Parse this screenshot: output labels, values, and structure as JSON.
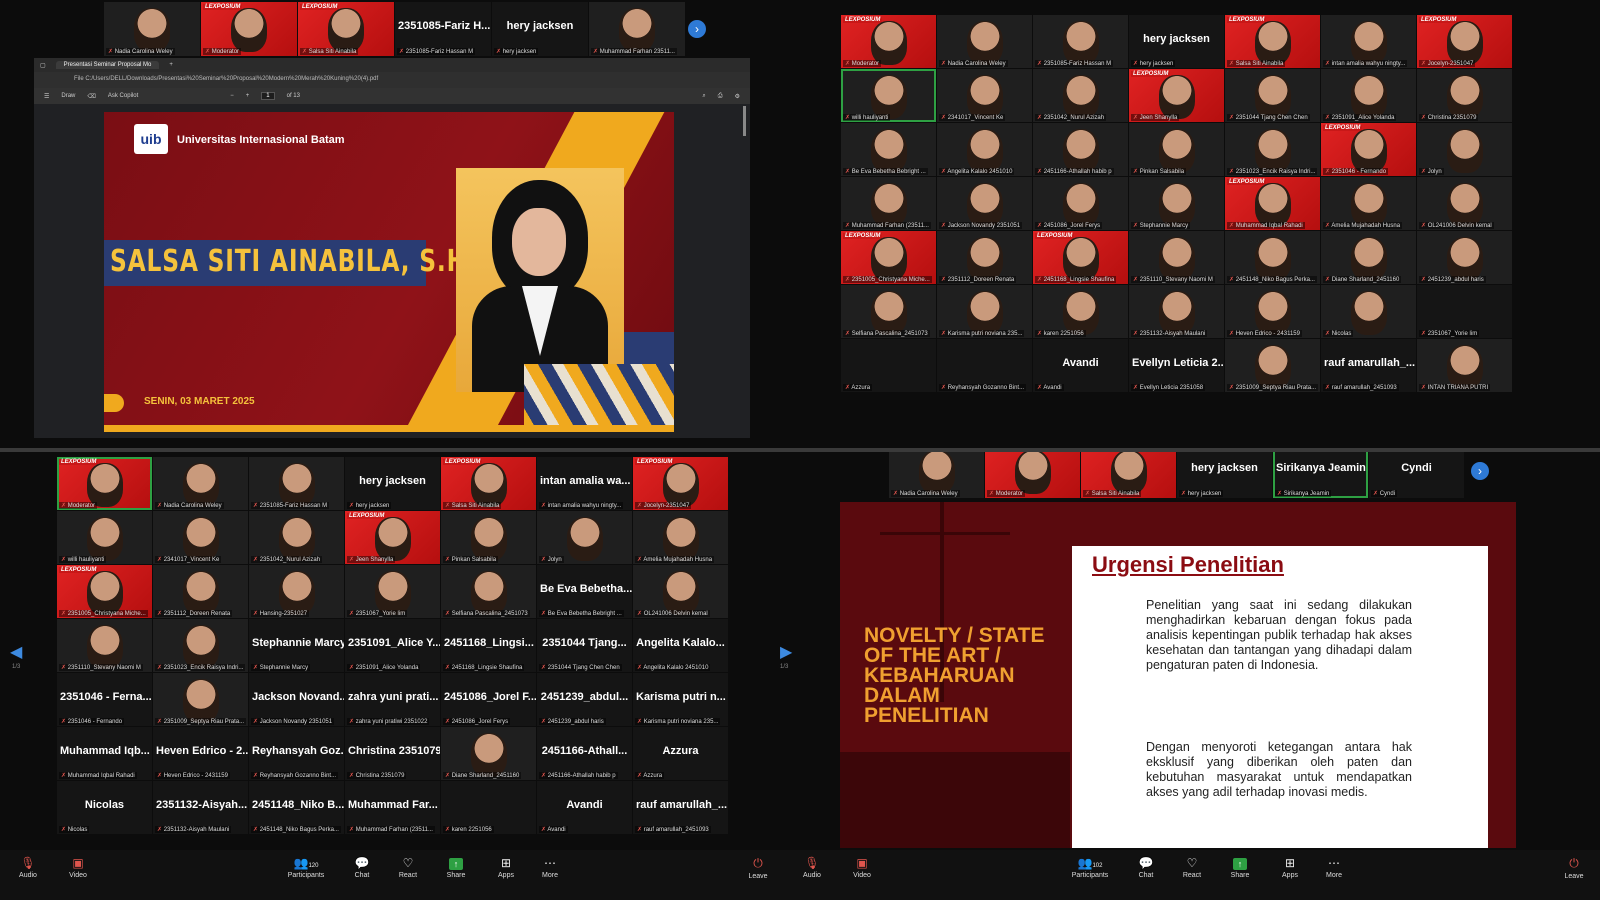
{
  "panel1": {
    "strip": [
      {
        "label": "Nadia Carolina Weley",
        "type": "photo"
      },
      {
        "label": "Moderator",
        "type": "red"
      },
      {
        "label": "Salsa Siti Ainabila",
        "type": "red"
      },
      {
        "label": "2351085-Fariz Hassan M",
        "type": "name",
        "display": "2351085-Fariz H..."
      },
      {
        "label": "hery jacksen",
        "type": "name",
        "display": "hery jacksen"
      },
      {
        "label": "Muhammad Farhan 23511...",
        "type": "photo"
      }
    ],
    "browser": {
      "tab_title": "Presentasi Seminar Proposal Mo",
      "address": "File   C:/Users/DELL/Downloads/Presentasi%20Seminar%20Proposal%20Modern%20Merah%20Kuning%20(4).pdf",
      "tools": [
        "Draw",
        "Ask Copilot"
      ],
      "page": "1",
      "page_total": "of 13"
    },
    "slide": {
      "logo": "uib",
      "university": "Universitas Internasional Batam",
      "name": "SALSA SITI AINABILA, S.H.",
      "date": "SENIN, 03 MARET 2025"
    }
  },
  "panel2": {
    "tiles": [
      {
        "label": "Moderator",
        "type": "red"
      },
      {
        "label": "Nadia Carolina Weley",
        "type": "photo"
      },
      {
        "label": "2351085-Fariz Hassan M",
        "type": "photo"
      },
      {
        "label": "hery jacksen",
        "type": "name",
        "display": "hery jacksen"
      },
      {
        "label": "Salsa Siti Ainabila",
        "type": "red"
      },
      {
        "label": "intan amalia wahyu ningty...",
        "type": "photo"
      },
      {
        "label": "Jocelyn-2351047",
        "type": "red"
      },
      {
        "label": "willi hauliyanti",
        "type": "photo",
        "hl": true
      },
      {
        "label": "2341017_Vincent Ke",
        "type": "photo"
      },
      {
        "label": "2351042_Nurul Azizah",
        "type": "photo"
      },
      {
        "label": "Jeen Shanylla",
        "type": "red"
      },
      {
        "label": "2351044 Tjang Chen Chen",
        "type": "photo"
      },
      {
        "label": "2351091_Alice Yolanda",
        "type": "photo"
      },
      {
        "label": "Christina 2351079",
        "type": "photo"
      },
      {
        "label": "Be Eva Bebetha Bebright ...",
        "type": "photo"
      },
      {
        "label": "Angelita Kalalo 2451010",
        "type": "photo"
      },
      {
        "label": "2451166-Athallah habib p",
        "type": "photo"
      },
      {
        "label": "Pinkan Salsabila",
        "type": "photo"
      },
      {
        "label": "2351023_Encik Raisya Indri...",
        "type": "photo"
      },
      {
        "label": "2351046 - Fernando",
        "type": "red"
      },
      {
        "label": "Jolyn",
        "type": "photo"
      },
      {
        "label": "Muhammad Farhan (23511...",
        "type": "photo"
      },
      {
        "label": "Jackson Novandy 2351051",
        "type": "photo"
      },
      {
        "label": "2451086_Jorel Ferys",
        "type": "photo"
      },
      {
        "label": "Stephannie Marcy",
        "type": "photo"
      },
      {
        "label": "Muhammad Iqbal Rahadi",
        "type": "red"
      },
      {
        "label": "Amelia Mujahadah Husna",
        "type": "photo"
      },
      {
        "label": "OL241006 Delvin kemal",
        "type": "photo"
      },
      {
        "label": "2351005_Christyana Miche...",
        "type": "red"
      },
      {
        "label": "2351112_Doreen Renata",
        "type": "photo"
      },
      {
        "label": "2451168_Lingsie Shaufina",
        "type": "red"
      },
      {
        "label": "2351110_Stevany Naomi M",
        "type": "photo"
      },
      {
        "label": "2451148_Niko Bagus Perka...",
        "type": "photo"
      },
      {
        "label": "Diane Sharland_2451160",
        "type": "photo"
      },
      {
        "label": "2451239_abdul haris",
        "type": "photo"
      },
      {
        "label": "Selfiana Pascalina_2451073",
        "type": "photo"
      },
      {
        "label": "Karisma putri noviana 235...",
        "type": "photo"
      },
      {
        "label": "karen 2251056",
        "type": "photo"
      },
      {
        "label": "2351132-Aisyah Maulani",
        "type": "photo"
      },
      {
        "label": "Heven Edrico - 2431159",
        "type": "photo"
      },
      {
        "label": "Nicolas",
        "type": "photo"
      },
      {
        "label": "2351067_Yorie lim",
        "type": "dark"
      },
      {
        "label": "Azzura",
        "type": "dark"
      },
      {
        "label": "Reyhansyah Gozanno Bint...",
        "type": "dark"
      },
      {
        "label": "Avandi",
        "type": "name",
        "display": "Avandi"
      },
      {
        "label": "Evellyn Leticia 2351058",
        "type": "name",
        "display": "Evellyn Leticia 2..."
      },
      {
        "label": "2351009_Septya Riau Prata...",
        "type": "photo"
      },
      {
        "label": "rauf amarullah_2451093",
        "type": "name",
        "display": "rauf amarullah_..."
      },
      {
        "label": "INTAN TRIANA PUTRI",
        "type": "photo"
      }
    ]
  },
  "panel3": {
    "tiles": [
      {
        "label": "Moderator",
        "type": "red",
        "hl": true
      },
      {
        "label": "Nadia Carolina Weley",
        "type": "photo"
      },
      {
        "label": "2351085-Fariz Hassan M",
        "type": "photo"
      },
      {
        "label": "hery jacksen",
        "type": "name",
        "display": "hery jacksen"
      },
      {
        "label": "Salsa Siti Ainabila",
        "type": "red"
      },
      {
        "label": "intan amalia wahyu ningty...",
        "type": "name",
        "display": "intan amalia wa..."
      },
      {
        "label": "Jocelyn-2351047",
        "type": "red"
      },
      {
        "label": "willi hauliyanti",
        "type": "photo"
      },
      {
        "label": "2341017_Vincent Ke",
        "type": "photo"
      },
      {
        "label": "2351042_Nurul Azizah",
        "type": "photo"
      },
      {
        "label": "Jeen Shanylla",
        "type": "red"
      },
      {
        "label": "Pinkan Salsabila",
        "type": "photo"
      },
      {
        "label": "Jolyn",
        "type": "photo"
      },
      {
        "label": "Amelia Mujahadah Husna",
        "type": "photo"
      },
      {
        "label": "2351005_Christyana Miche...",
        "type": "red"
      },
      {
        "label": "2351112_Doreen Renata",
        "type": "photo"
      },
      {
        "label": "Hansing-2351027",
        "type": "photo"
      },
      {
        "label": "2351067_Yorie lim",
        "type": "photo"
      },
      {
        "label": "Selfiana Pascalina_2451073",
        "type": "photo"
      },
      {
        "label": "Be Eva Bebetha Bebright ...",
        "type": "name",
        "display": "Be Eva Bebetha..."
      },
      {
        "label": "OL241006 Delvin kemal",
        "type": "photo"
      },
      {
        "label": "2351110_Stevany Naomi M",
        "type": "photo"
      },
      {
        "label": "2351023_Encik Raisya Indri...",
        "type": "photo"
      },
      {
        "label": "Stephannie Marcy",
        "type": "name",
        "display": "Stephannie Marcy"
      },
      {
        "label": "2351091_Alice Yolanda",
        "type": "name",
        "display": "2351091_Alice Y..."
      },
      {
        "label": "2451168_Lingsie Shaufina",
        "type": "name",
        "display": "2451168_Lingsi..."
      },
      {
        "label": "2351044 Tjang Chen Chen",
        "type": "name",
        "display": "2351044 Tjang..."
      },
      {
        "label": "Angelita Kalalo 2451010",
        "type": "name",
        "display": "Angelita Kalalo..."
      },
      {
        "label": "2351046 - Fernando",
        "type": "name",
        "display": "2351046 - Ferna..."
      },
      {
        "label": "2351009_Septya Riau Prata...",
        "type": "photo"
      },
      {
        "label": "Jackson Novandy 2351051",
        "type": "name",
        "display": "Jackson Novand..."
      },
      {
        "label": "zahra yuni pratiwi 2351022",
        "type": "name",
        "display": "zahra yuni prati..."
      },
      {
        "label": "2451086_Jorel Ferys",
        "type": "name",
        "display": "2451086_Jorel F..."
      },
      {
        "label": "2451239_abdul haris",
        "type": "name",
        "display": "2451239_abdul..."
      },
      {
        "label": "Karisma putri noviana 235...",
        "type": "name",
        "display": "Karisma putri n..."
      },
      {
        "label": "Muhammad Iqbal Rahadi",
        "type": "name",
        "display": "Muhammad Iqb..."
      },
      {
        "label": "Heven Edrico - 2431159",
        "type": "name",
        "display": "Heven Edrico - 2..."
      },
      {
        "label": "Reyhansyah Gozanno Bint...",
        "type": "name",
        "display": "Reyhansyah Goz..."
      },
      {
        "label": "Christina 2351079",
        "type": "name",
        "display": "Christina 2351079"
      },
      {
        "label": "Diane Sharland_2451160",
        "type": "photo"
      },
      {
        "label": "2451166-Athallah habib p",
        "type": "name",
        "display": "2451166-Athall..."
      },
      {
        "label": "Azzura",
        "type": "name",
        "display": "Azzura"
      },
      {
        "label": "Nicolas",
        "type": "name",
        "display": "Nicolas"
      },
      {
        "label": "2351132-Aisyah Maulani",
        "type": "name",
        "display": "2351132-Aisyah..."
      },
      {
        "label": "2451148_Niko Bagus Perka...",
        "type": "name",
        "display": "2451148_Niko B..."
      },
      {
        "label": "Muhammad Farhan (23511...",
        "type": "name",
        "display": "Muhammad Far..."
      },
      {
        "label": "karen 2251056",
        "type": "dark"
      },
      {
        "label": "Avandi",
        "type": "name",
        "display": "Avandi"
      },
      {
        "label": "rauf amarullah_2451093",
        "type": "name",
        "display": "rauf amarullah_..."
      }
    ],
    "page_indicator": "1/3",
    "page_indicator_right": "1/3"
  },
  "panel4": {
    "strip": [
      {
        "label": "Nadia Carolina Weley",
        "type": "photo"
      },
      {
        "label": "Moderator",
        "type": "red"
      },
      {
        "label": "Salsa Siti Ainabila",
        "type": "red"
      },
      {
        "label": "hery jacksen",
        "type": "name",
        "display": "hery jacksen"
      },
      {
        "label": "Sirikanya Jeamin",
        "type": "name",
        "display": "Sirikanya Jeamin",
        "hl": true
      },
      {
        "label": "Cyndi",
        "type": "name",
        "display": "Cyndi"
      }
    ],
    "slide": {
      "novelty": "NOVELTY / STATE OF THE ART / KEBAHARUAN DALAM PENELITIAN",
      "heading": "Urgensi Penelitian",
      "para1": "Penelitian yang saat ini sedang dilakukan menghadirkan kebaruan dengan fokus pada analisis kepentingan publik terhadap hak akses kesehatan dan tantangan yang dihadapi dalam pengaturan paten di Indonesia.",
      "para2": "Dengan menyoroti ketegangan antara hak eksklusif yang diberikan oleh paten dan kebutuhan masyarakat untuk mendapatkan akses yang adil terhadap inovasi medis."
    }
  },
  "toolbar_left": {
    "audio": "Audio",
    "video": "Video",
    "participants": "Participants",
    "participants_count": "120",
    "chat": "Chat",
    "react": "React",
    "share": "Share",
    "apps": "Apps",
    "more": "More",
    "leave": "Leave"
  },
  "toolbar_right": {
    "audio": "Audio",
    "video": "Video",
    "participants": "Participants",
    "participants_count": "102",
    "chat": "Chat",
    "react": "React",
    "share": "Share",
    "apps": "Apps",
    "more": "More",
    "leave": "Leave"
  }
}
